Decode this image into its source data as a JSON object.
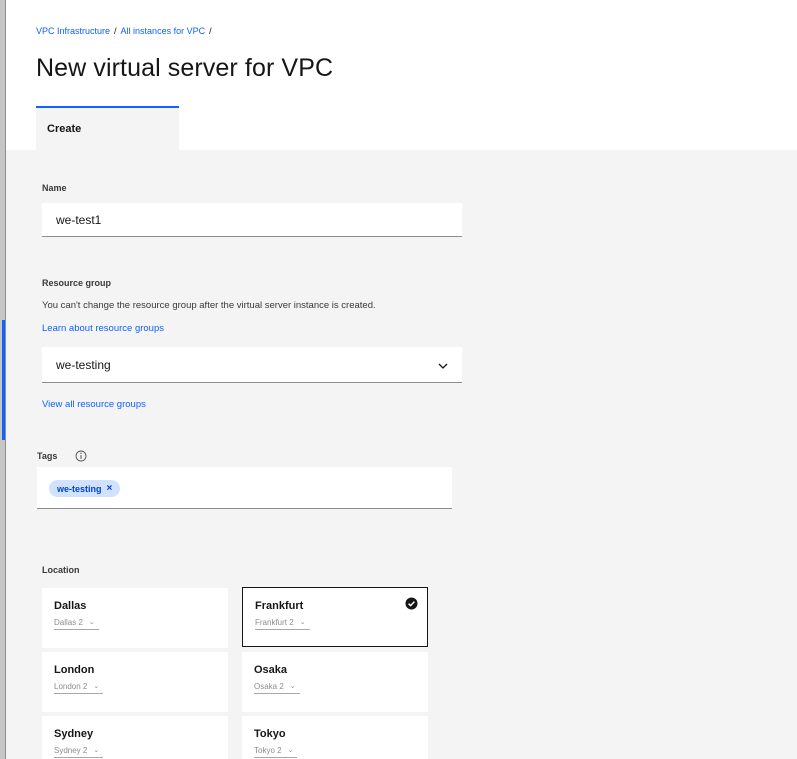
{
  "breadcrumb": {
    "items": [
      "VPC Infrastructure",
      "All instances for VPC"
    ],
    "separator": "/"
  },
  "page": {
    "title": "New virtual server for VPC"
  },
  "tabs": [
    {
      "label": "Create",
      "active": true
    }
  ],
  "name_field": {
    "label": "Name",
    "value": "we-test1"
  },
  "resource_group": {
    "label": "Resource group",
    "helper": "You can't change the resource group after the virtual server instance is created.",
    "learn_link": "Learn about resource groups",
    "selected": "we-testing",
    "view_all_link": "View all resource groups"
  },
  "tags": {
    "label": "Tags",
    "items": [
      {
        "text": "we-testing",
        "remove": "×"
      }
    ]
  },
  "location": {
    "label": "Location",
    "tiles": [
      {
        "name": "Dallas",
        "zone": "Dallas 2",
        "selected": false
      },
      {
        "name": "Frankfurt",
        "zone": "Frankfurt 2",
        "selected": true
      },
      {
        "name": "London",
        "zone": "London 2",
        "selected": false
      },
      {
        "name": "Osaka",
        "zone": "Osaka 2",
        "selected": false
      },
      {
        "name": "Sydney",
        "zone": "Sydney 2",
        "selected": false
      },
      {
        "name": "Tokyo",
        "zone": "Tokyo 2",
        "selected": false
      }
    ],
    "caret": "⌄"
  },
  "colors": {
    "accent": "#0f62fe",
    "tag_bg": "#d0e2ff",
    "background": "#f4f4f4"
  }
}
